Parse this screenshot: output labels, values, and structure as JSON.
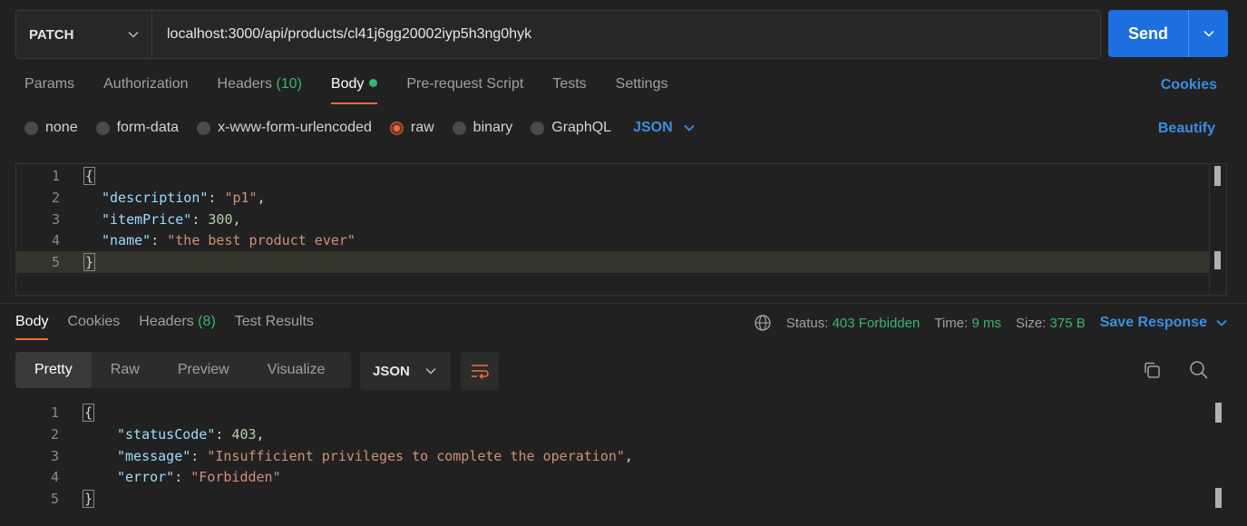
{
  "request": {
    "method": "PATCH",
    "url": "localhost:3000/api/products/cl41j6gg20002iyp5h3ng0hyk",
    "send_label": "Send"
  },
  "request_tabs": [
    {
      "label": "Params"
    },
    {
      "label": "Authorization"
    },
    {
      "label": "Headers",
      "count": "(10)"
    },
    {
      "label": "Body",
      "active": true
    },
    {
      "label": "Pre-request Script"
    },
    {
      "label": "Tests"
    },
    {
      "label": "Settings"
    }
  ],
  "cookies_label": "Cookies",
  "body_types": [
    {
      "label": "none"
    },
    {
      "label": "form-data"
    },
    {
      "label": "x-www-form-urlencoded"
    },
    {
      "label": "raw",
      "selected": true
    },
    {
      "label": "binary"
    },
    {
      "label": "GraphQL"
    }
  ],
  "body_language": "JSON",
  "beautify_label": "Beautify",
  "request_body": {
    "line_numbers": [
      "1",
      "2",
      "3",
      "4",
      "5"
    ],
    "open_brace": "{",
    "close_brace": "}",
    "fields": [
      {
        "key": "\"description\"",
        "value": "\"p1\"",
        "value_type": "string",
        "comma": ","
      },
      {
        "key": "\"itemPrice\"",
        "value": "300",
        "value_type": "number",
        "comma": ","
      },
      {
        "key": "\"name\"",
        "value": "\"the best product ever\"",
        "value_type": "string",
        "comma": ""
      }
    ]
  },
  "response_tabs": [
    {
      "label": "Body",
      "active": true
    },
    {
      "label": "Cookies"
    },
    {
      "label": "Headers",
      "count": "(8)"
    },
    {
      "label": "Test Results"
    }
  ],
  "response_status": {
    "status_label": "Status:",
    "status_value": "403 Forbidden",
    "time_label": "Time:",
    "time_value": "9 ms",
    "size_label": "Size:",
    "size_value": "375 B",
    "save_label": "Save Response"
  },
  "view_tabs": [
    {
      "label": "Pretty",
      "active": true
    },
    {
      "label": "Raw"
    },
    {
      "label": "Preview"
    },
    {
      "label": "Visualize"
    }
  ],
  "response_format": "JSON",
  "response_body": {
    "line_numbers": [
      "1",
      "2",
      "3",
      "4",
      "5"
    ],
    "open_brace": "{",
    "close_brace": "}",
    "fields": [
      {
        "key": "\"statusCode\"",
        "value": "403",
        "value_type": "number",
        "comma": ","
      },
      {
        "key": "\"message\"",
        "value": "\"Insufficient privileges to complete the operation\"",
        "value_type": "string",
        "comma": ","
      },
      {
        "key": "\"error\"",
        "value": "\"Forbidden\"",
        "value_type": "string",
        "comma": ""
      }
    ]
  },
  "colors": {
    "accent": "#f26b3a",
    "link": "#3a8fe0",
    "success": "#3ab56a",
    "send_button": "#1d6fe0"
  },
  "icons": [
    "chevron-down-icon",
    "globe-icon",
    "wrap-lines-icon",
    "copy-icon",
    "search-icon"
  ]
}
